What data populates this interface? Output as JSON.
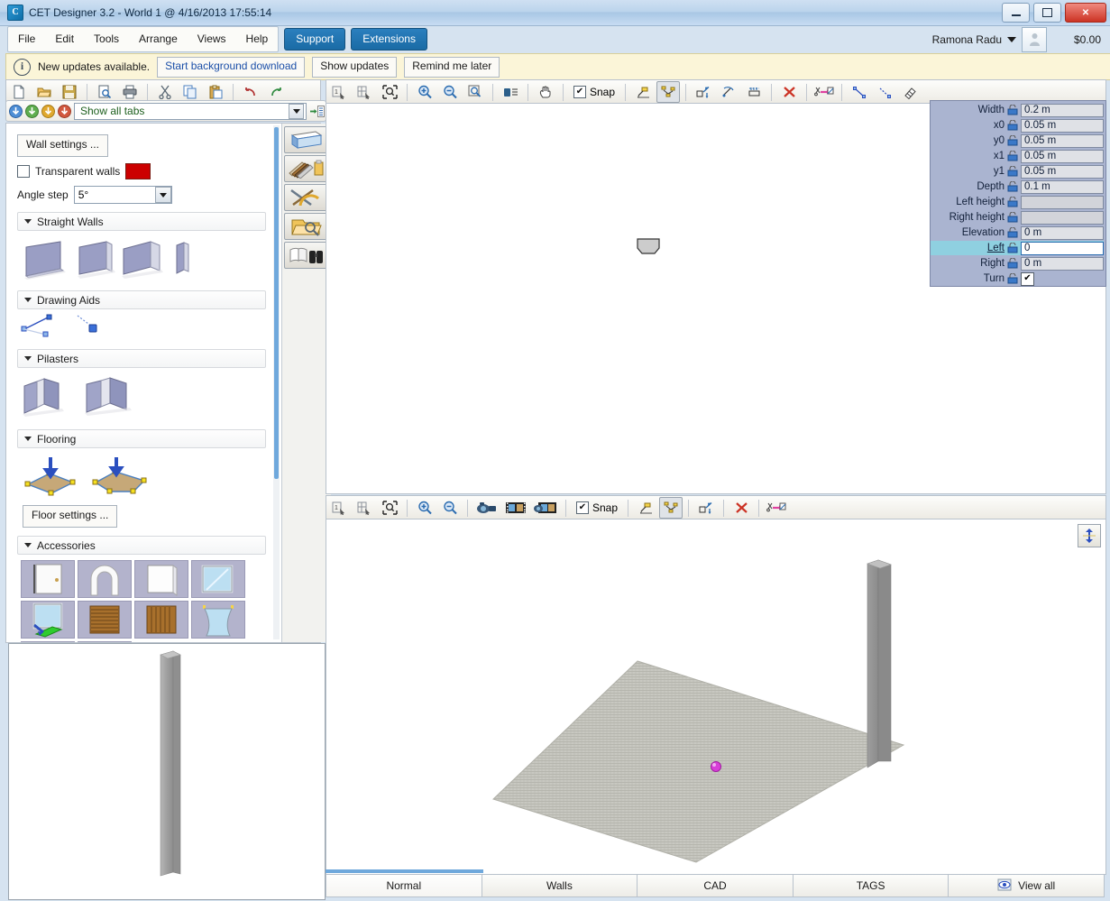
{
  "window": {
    "title": "CET Designer 3.2 - World 1 @ 4/16/2013 17:55:14",
    "app_badge": "C",
    "minimize_label": "Minimize",
    "maximize_label": "Maximize",
    "close_label": "✕"
  },
  "menubar": {
    "items": [
      "File",
      "Edit",
      "Tools",
      "Arrange",
      "Views",
      "Help"
    ],
    "pills": [
      "Support",
      "Extensions"
    ],
    "user": "Ramona Radu",
    "price": "$0.00",
    "user_caret_icon": "chevron-down-icon",
    "avatar_icon": "person-icon"
  },
  "update_bar": {
    "info_icon": "info-icon",
    "message": "New updates available.",
    "buttons": [
      "Start background download",
      "Show updates",
      "Remind me later"
    ]
  },
  "file_toolbar": {
    "buttons": [
      {
        "name": "new-document-icon",
        "title": "New"
      },
      {
        "name": "open-folder-icon",
        "title": "Open"
      },
      {
        "name": "save-disk-icon",
        "title": "Save"
      },
      {
        "name": "print-preview-icon",
        "title": "Print preview"
      },
      {
        "name": "print-icon",
        "title": "Print"
      },
      {
        "name": "cut-scissors-icon",
        "title": "Cut"
      },
      {
        "name": "copy-icon",
        "title": "Copy"
      },
      {
        "name": "paste-icon",
        "title": "Paste"
      },
      {
        "name": "undo-arrow-icon",
        "title": "Undo"
      },
      {
        "name": "redo-arrow-icon",
        "title": "Redo"
      }
    ]
  },
  "plan_toolbar": {
    "snap_label": "Snap",
    "snap_checked": true,
    "buttons": [
      {
        "name": "select-one-icon",
        "title": "Select single"
      },
      {
        "name": "select-area-icon",
        "title": "Select area"
      },
      {
        "name": "zoom-extents-icon",
        "title": "Zoom extents"
      },
      {
        "name": "zoom-in-icon",
        "title": "Zoom in"
      },
      {
        "name": "zoom-out-icon",
        "title": "Zoom out"
      },
      {
        "name": "zoom-window-icon",
        "title": "Zoom window"
      },
      {
        "name": "properties-icon",
        "title": "Properties"
      },
      {
        "name": "pan-hand-icon",
        "title": "Pan"
      },
      {
        "name": "snap-point-icon",
        "title": "Snap point"
      },
      {
        "name": "snap-grid-icon",
        "title": "Snap grid"
      },
      {
        "name": "scale-icon",
        "title": "Scale"
      },
      {
        "name": "rotate-icon",
        "title": "Rotate"
      },
      {
        "name": "align-icon",
        "title": "Align"
      },
      {
        "name": "delete-x-icon",
        "title": "Delete"
      },
      {
        "name": "cut-paste-icon",
        "title": "Cut and paste"
      },
      {
        "name": "measure-line-icon",
        "title": "Measure"
      },
      {
        "name": "dimension-line-icon",
        "title": "Dimension"
      },
      {
        "name": "eraser-icon",
        "title": "Eraser"
      }
    ]
  },
  "view3d_toolbar": {
    "snap_label": "Snap",
    "snap_checked": true,
    "buttons": [
      {
        "name": "select-one-icon",
        "title": "Select single"
      },
      {
        "name": "select-area-icon",
        "title": "Select area"
      },
      {
        "name": "zoom-extents-icon",
        "title": "Zoom extents"
      },
      {
        "name": "zoom-in-icon",
        "title": "Zoom in"
      },
      {
        "name": "zoom-out-icon",
        "title": "Zoom out"
      },
      {
        "name": "camera-icon",
        "title": "Camera"
      },
      {
        "name": "filmstrip-icon",
        "title": "Render image"
      },
      {
        "name": "film-camera-icon",
        "title": "Render movie"
      },
      {
        "name": "snap-point-icon",
        "title": "Snap point"
      },
      {
        "name": "snap-grid-icon",
        "title": "Snap grid"
      },
      {
        "name": "scale-icon",
        "title": "Scale"
      },
      {
        "name": "delete-x-icon",
        "title": "Delete"
      },
      {
        "name": "cut-paste-icon",
        "title": "Cut and paste"
      }
    ]
  },
  "tabbar": {
    "nav_icons": [
      "back-blue-icon",
      "down-green-icon",
      "down-yellow-icon",
      "down-red-icon"
    ],
    "selected_tab": "Show all tabs",
    "list_icon": "tab-list-icon"
  },
  "sidebar": {
    "wall_settings_label": "Wall settings ...",
    "transparent_walls_label": "Transparent walls",
    "transparent_walls_checked": false,
    "transparent_walls_color": "#cc0000",
    "angle_step_label": "Angle step",
    "angle_step_value": "5°",
    "floor_settings_label": "Floor settings ...",
    "sections": [
      {
        "title": "Straight Walls",
        "expanded": true,
        "items": [
          "wall-flat-icon",
          "wall-angled-icon",
          "wall-thick-icon",
          "wall-narrow-icon"
        ]
      },
      {
        "title": "Drawing Aids",
        "expanded": true,
        "items": [
          "guide-line-icon",
          "guide-point-icon"
        ]
      },
      {
        "title": "Pilasters",
        "expanded": true,
        "items": [
          "pilaster-double-icon",
          "pilaster-wide-icon"
        ]
      },
      {
        "title": "Flooring",
        "expanded": true,
        "items": [
          "floor-square-icon",
          "floor-polygon-icon"
        ]
      },
      {
        "title": "Accessories",
        "expanded": true,
        "items": [
          "door-single-icon",
          "archway-icon",
          "panel-icon",
          "window-icon",
          "window-open-icon",
          "shutter-horizontal-icon",
          "shutter-vertical-icon",
          "curtain-icon",
          "sliding-door-icon",
          "glass-door-icon"
        ]
      }
    ],
    "vtools": [
      {
        "name": "room-box-icon",
        "title": "Room"
      },
      {
        "name": "materials-palette-icon",
        "title": "Materials"
      },
      {
        "name": "drawing-tools-icon",
        "title": "Drawing tools"
      },
      {
        "name": "search-folder-icon",
        "title": "Find"
      },
      {
        "name": "binoculars-book-icon",
        "title": "Explore"
      }
    ]
  },
  "properties": {
    "rows": [
      {
        "label": "Width",
        "value": "0.2 m",
        "type": "text",
        "state": "normal"
      },
      {
        "label": "x0",
        "value": "0.05 m",
        "type": "text",
        "state": "normal"
      },
      {
        "label": "y0",
        "value": "0.05 m",
        "type": "text",
        "state": "normal"
      },
      {
        "label": "x1",
        "value": "0.05 m",
        "type": "text",
        "state": "normal"
      },
      {
        "label": "y1",
        "value": "0.05 m",
        "type": "text",
        "state": "normal"
      },
      {
        "label": "Depth",
        "value": "0.1 m",
        "type": "text",
        "state": "normal"
      },
      {
        "label": "Left height",
        "value": "",
        "type": "text",
        "state": "disabled"
      },
      {
        "label": "Right height",
        "value": "",
        "type": "text",
        "state": "disabled"
      },
      {
        "label": "Elevation",
        "value": "0 m",
        "type": "text",
        "state": "normal"
      },
      {
        "label": "Left",
        "value": "0",
        "type": "text",
        "state": "editing"
      },
      {
        "label": "Right",
        "value": "0 m",
        "type": "text",
        "state": "normal"
      },
      {
        "label": "Turn",
        "value": "✔",
        "type": "checkbox",
        "state": "normal"
      }
    ],
    "lock_icon": "lock-dimension-icon"
  },
  "viewport_3d": {
    "flip_icon": "flip-vertical-icon",
    "objects": [
      "floor-plane",
      "wall-segment",
      "pink-marker"
    ]
  },
  "bottom_tabs": {
    "tabs": [
      "Normal",
      "Walls",
      "CAD",
      "TAGS"
    ],
    "active": "Normal",
    "view_all_label": "View all",
    "view_all_icon": "eye-icon"
  }
}
